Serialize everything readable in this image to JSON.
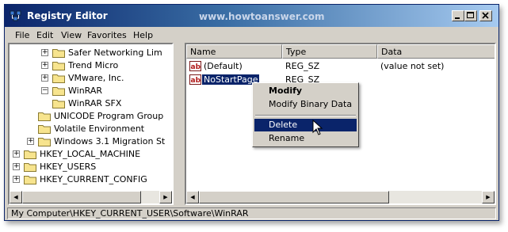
{
  "window": {
    "title": "Registry Editor",
    "watermark": "www.howtoanswer.com"
  },
  "title_buttons": [
    {
      "name": "minimize-button",
      "glyph": "_"
    },
    {
      "name": "maximize-button",
      "glyph": "□"
    },
    {
      "name": "close-button",
      "glyph": "×"
    }
  ],
  "menu": [
    "File",
    "Edit",
    "View",
    "Favorites",
    "Help"
  ],
  "tree": [
    {
      "label": "Safer Networking Lim",
      "expander": "+",
      "level": 3
    },
    {
      "label": "Trend Micro",
      "expander": "+",
      "level": 3
    },
    {
      "label": "VMware, Inc.",
      "expander": "+",
      "level": 3
    },
    {
      "label": "WinRAR",
      "expander": "−",
      "level": 3
    },
    {
      "label": "WinRAR SFX",
      "expander": "",
      "level": 3
    },
    {
      "label": "UNICODE Program Group",
      "expander": "",
      "level": 2
    },
    {
      "label": "Volatile Environment",
      "expander": "",
      "level": 2
    },
    {
      "label": "Windows 3.1 Migration St",
      "expander": "+",
      "level": 2
    },
    {
      "label": "HKEY_LOCAL_MACHINE",
      "expander": "+",
      "level": 1
    },
    {
      "label": "HKEY_USERS",
      "expander": "+",
      "level": 1
    },
    {
      "label": "HKEY_CURRENT_CONFIG",
      "expander": "+",
      "level": 1
    }
  ],
  "list": {
    "columns": [
      "Name",
      "Type",
      "Data"
    ],
    "rows": [
      {
        "name": "(Default)",
        "type": "REG_SZ",
        "data": "(value not set)",
        "icon": "string-value-icon",
        "selected": false
      },
      {
        "name": "NoStartPage",
        "type": "REG_SZ",
        "data": "",
        "icon": "string-value-icon",
        "selected": true
      }
    ]
  },
  "context_menu": {
    "items": [
      {
        "label": "Modify",
        "bold": true,
        "highlighted": false
      },
      {
        "label": "Modify Binary Data",
        "bold": false,
        "highlighted": false
      },
      {
        "label": "Delete",
        "bold": false,
        "highlighted": true
      },
      {
        "label": "Rename",
        "bold": false,
        "highlighted": false
      }
    ]
  },
  "status": {
    "path": "My Computer\\HKEY_CURRENT_USER\\Software\\WinRAR"
  },
  "colors": {
    "title_bar": "#0a246a",
    "selection": "#0a246a",
    "window_face": "#d4d0c8"
  }
}
